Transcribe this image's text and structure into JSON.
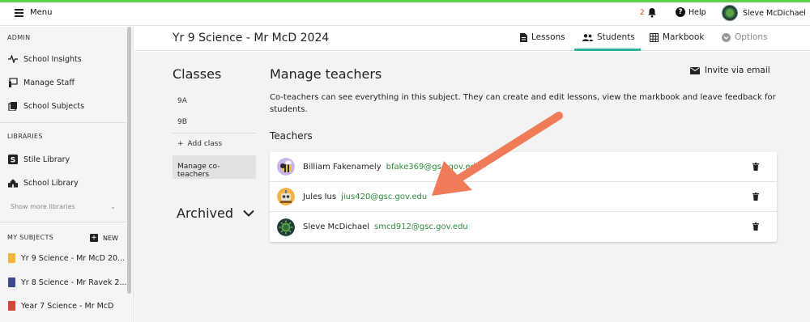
{
  "topbar": {
    "menu_label": "Menu",
    "notif_count": "2",
    "help_label": "Help",
    "user_name": "Sleve McDichael"
  },
  "sidebar": {
    "admin_heading": "ADMIN",
    "admin_items": [
      "School Insights",
      "Manage Staff",
      "School Subjects"
    ],
    "libraries_heading": "LIBRARIES",
    "library_items": [
      "Stile Library",
      "School Library"
    ],
    "show_more": "Show more libraries",
    "my_subjects_heading": "MY SUBJECTS",
    "new_label": "NEW",
    "subjects": [
      {
        "label": "Yr 9 Science - Mr McD 20...",
        "color": "#f2b53c"
      },
      {
        "label": "Yr 8 Science - Mr Ravek 2...",
        "color": "#3f4a8f"
      },
      {
        "label": "Year 7 Science - Mr McD",
        "color": "#d8433a"
      }
    ]
  },
  "header": {
    "title": "Yr 9 Science - Mr McD 2024",
    "tabs": {
      "lessons": "Lessons",
      "students": "Students",
      "markbook": "Markbook",
      "options": "Options"
    },
    "accent": "#2fb39a"
  },
  "classes": {
    "title": "Classes",
    "items": [
      "9A",
      "9B"
    ],
    "add_class": "Add class",
    "manage_co": "Manage co-teachers",
    "archived": "Archived"
  },
  "manage": {
    "title": "Manage teachers",
    "invite": "Invite via email",
    "description": "Co-teachers can see everything in this subject. They can create and edit lessons, view the markbook and leave feedback for students.",
    "teachers_label": "Teachers",
    "teachers": [
      {
        "name": "Billiam Fakenamely",
        "email": "bfake369@gsc.gov.edu",
        "avatar": "bee-avatar"
      },
      {
        "name": "Jules Ius",
        "email": "jius420@gsc.gov.edu",
        "avatar": "robot-avatar"
      },
      {
        "name": "Sleve McDichael",
        "email": "smcd912@gsc.gov.edu",
        "avatar": "virus-avatar"
      }
    ]
  },
  "annotation": {
    "arrow_color": "#ef7b58"
  }
}
